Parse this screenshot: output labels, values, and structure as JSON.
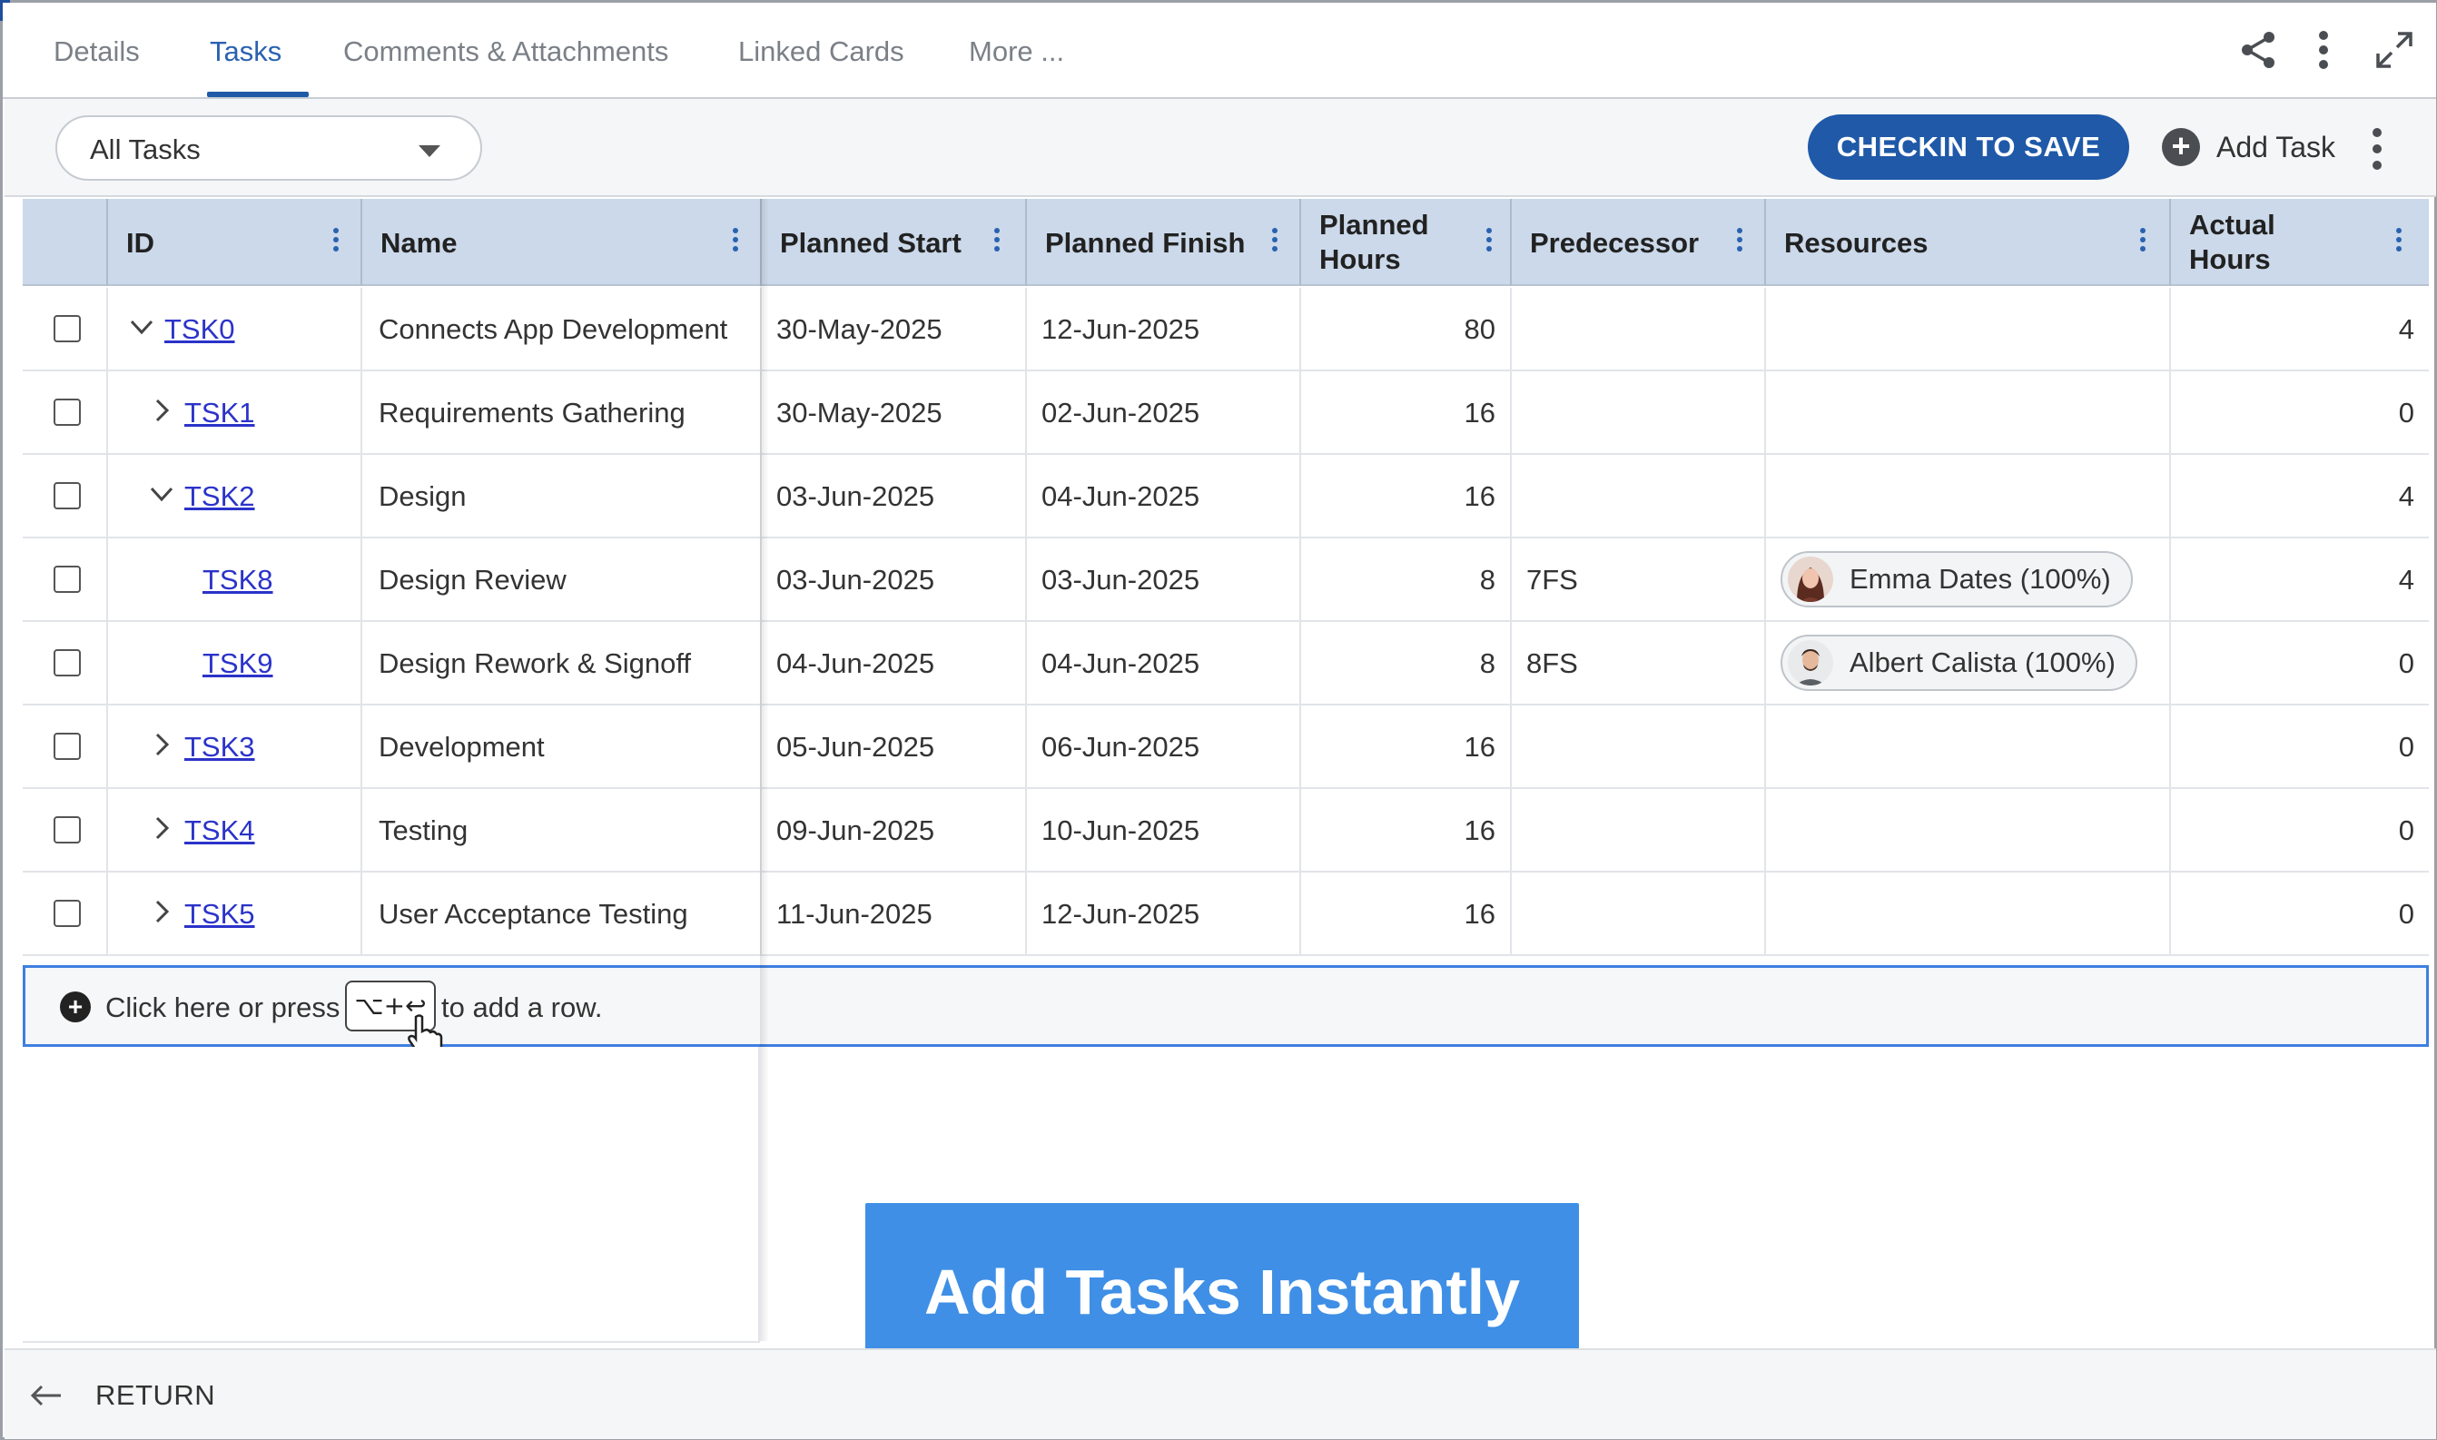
{
  "tabs": [
    {
      "label": "Details"
    },
    {
      "label": "Tasks"
    },
    {
      "label": "Comments & Attachments"
    },
    {
      "label": "Linked Cards"
    },
    {
      "label": "More ..."
    }
  ],
  "toolbar": {
    "filter_value": "All Tasks",
    "checkin_label": "CHECKIN TO SAVE",
    "add_task_label": "Add Task"
  },
  "columns": {
    "id": "ID",
    "name": "Name",
    "planned_start": "Planned Start",
    "planned_finish": "Planned Finish",
    "planned_hours_1": "Planned",
    "planned_hours_2": "Hours",
    "predecessor": "Predecessor",
    "resources": "Resources",
    "actual_hours_1": "Actual",
    "actual_hours_2": "Hours"
  },
  "rows": [
    {
      "id": "TSK0",
      "name": "Connects App Development",
      "start": "30-May-2025",
      "finish": "12-Jun-2025",
      "planned": "80",
      "pred": "",
      "resource": "",
      "actual": "4",
      "toggle": "expanded",
      "level": 0
    },
    {
      "id": "TSK1",
      "name": "Requirements Gathering",
      "start": "30-May-2025",
      "finish": "02-Jun-2025",
      "planned": "16",
      "pred": "",
      "resource": "",
      "actual": "0",
      "toggle": "collapsed",
      "level": 1
    },
    {
      "id": "TSK2",
      "name": "Design",
      "start": "03-Jun-2025",
      "finish": "04-Jun-2025",
      "planned": "16",
      "pred": "",
      "resource": "",
      "actual": "4",
      "toggle": "expanded",
      "level": 1
    },
    {
      "id": "TSK8",
      "name": "Design Review",
      "start": "03-Jun-2025",
      "finish": "03-Jun-2025",
      "planned": "8",
      "pred": "7FS",
      "resource": "Emma Dates (100%)",
      "actual": "4",
      "toggle": "none",
      "level": 2
    },
    {
      "id": "TSK9",
      "name": "Design Rework & Signoff",
      "start": "04-Jun-2025",
      "finish": "04-Jun-2025",
      "planned": "8",
      "pred": "8FS",
      "resource": "Albert Calista (100%)",
      "actual": "0",
      "toggle": "none",
      "level": 2
    },
    {
      "id": "TSK3",
      "name": "Development",
      "start": "05-Jun-2025",
      "finish": "06-Jun-2025",
      "planned": "16",
      "pred": "",
      "resource": "",
      "actual": "0",
      "toggle": "collapsed",
      "level": 1
    },
    {
      "id": "TSK4",
      "name": "Testing",
      "start": "09-Jun-2025",
      "finish": "10-Jun-2025",
      "planned": "16",
      "pred": "",
      "resource": "",
      "actual": "0",
      "toggle": "collapsed",
      "level": 1
    },
    {
      "id": "TSK5",
      "name": "User Acceptance Testing",
      "start": "11-Jun-2025",
      "finish": "12-Jun-2025",
      "planned": "16",
      "pred": "",
      "resource": "",
      "actual": "0",
      "toggle": "collapsed",
      "level": 1
    }
  ],
  "add_row": {
    "prefix": "Click here or press",
    "shortcut": "⌥+↩",
    "suffix": "to add a row."
  },
  "banner": {
    "text": "Add Tasks Instantly"
  },
  "footer": {
    "return_label": "RETURN"
  },
  "colors": {
    "accent": "#1f59a8",
    "link": "#2b33c9",
    "header_bg": "#cbd9ea",
    "banner": "#3f8fe6"
  }
}
